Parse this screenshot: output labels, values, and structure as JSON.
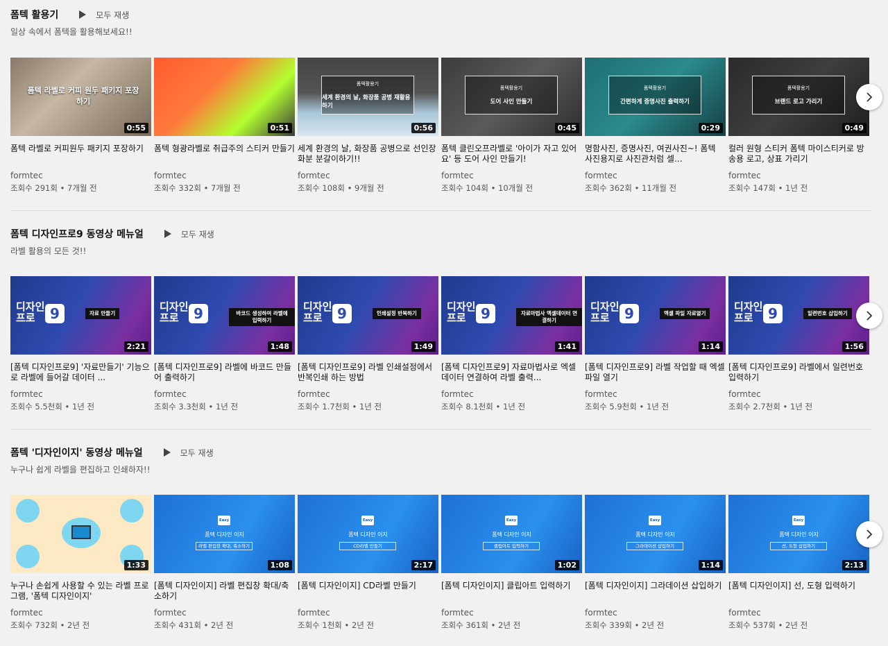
{
  "shelves": [
    {
      "title": "폼텍 활용기",
      "play_all": "모두 재생",
      "subtitle": "일상 속에서 폼텍을 활용해보세요!!",
      "videos": [
        {
          "title": "폼텍 라벨로 커피원두 패키지 포장하기",
          "channel": "formtec",
          "meta": "조회수 291회 • 7개월 전",
          "duration": "0:55",
          "thumb_text": "폼텍 라벨로 커피 원두 패키지 포장하기"
        },
        {
          "title": "폼텍 형광라벨로 취급주의 스티커 만들기",
          "channel": "formtec",
          "meta": "조회수 332회 • 7개월 전",
          "duration": "0:51",
          "thumb_text": ""
        },
        {
          "title": "세계 환경의 날, 화장품 공병으로 선인장 화분 분갈이하기!!",
          "channel": "formtec",
          "meta": "조회수 108회 • 9개월 전",
          "duration": "0:56",
          "thumb_small": "폼텍활용기",
          "thumb_text": "세계 환경의 날, 화장품 공병 재활용하기"
        },
        {
          "title": "폼텍 클린오프라벨로 '아이가 자고 있어요' 등 도어 사인 만들기!",
          "channel": "formtec",
          "meta": "조회수 104회 • 10개월 전",
          "duration": "0:45",
          "thumb_small": "폼텍활용기",
          "thumb_text": "도어 사인 만들기"
        },
        {
          "title": "명함사진, 증명사진, 여권사진~! 폼텍 사진용지로 사진관처럼 셀...",
          "channel": "formtec",
          "meta": "조회수 362회 • 11개월 전",
          "duration": "0:29",
          "thumb_small": "폼텍활용기",
          "thumb_text": "간편하게 증명사진 출력하기"
        },
        {
          "title": "컬러 원형 스티커 폼텍 마이스티커로 방송용 로고, 상표 가리기",
          "channel": "formtec",
          "meta": "조회수 147회 • 1년 전",
          "duration": "0:49",
          "thumb_small": "폼텍활용기",
          "thumb_text": "브랜드 로고 가리기"
        }
      ]
    },
    {
      "title": "폼텍 디자인프로9 동영상 메뉴얼",
      "play_all": "모두 재생",
      "subtitle": "라벨 활용의 모든 것!!",
      "videos": [
        {
          "title": "[폼텍 디자인프로9] '자료만들기' 기능으로 라벨에 들어갈 데이터 ...",
          "channel": "formtec",
          "meta": "조회수 5.5천회 • 1년 전",
          "duration": "2:21",
          "thumb_text": "자료 만들기"
        },
        {
          "title": "[폼텍 디자인프로9] 라벨에 바코드 만들어 출력하기",
          "channel": "formtec",
          "meta": "조회수 3.3천회 • 1년 전",
          "duration": "1:48",
          "thumb_text": "바코드 생성하여 라벨에 입력하기"
        },
        {
          "title": "[폼텍 디자인프로9] 라벨 인쇄설정에서 반복인쇄 하는 방법",
          "channel": "formtec",
          "meta": "조회수 1.7천회 • 1년 전",
          "duration": "1:49",
          "thumb_text": "인쇄설정 반복하기"
        },
        {
          "title": "[폼텍 디자인프로9] 자료마법사로 엑셀 데이터 연결하여 라벨 출력...",
          "channel": "formtec",
          "meta": "조회수 8.1천회 • 1년 전",
          "duration": "1:41",
          "thumb_text": "자료마법사 엑셀데이터 연결하기"
        },
        {
          "title": "[폼텍 디자인프로9] 라벨 작업할 때 엑셀 파일 열기",
          "channel": "formtec",
          "meta": "조회수 5.9천회 • 1년 전",
          "duration": "1:14",
          "thumb_text": "엑셀 파일 자료열기"
        },
        {
          "title": "[폼텍 디자인프로9] 라벨에서 일련번호 입력하기",
          "channel": "formtec",
          "meta": "조회수 2.7천회 • 1년 전",
          "duration": "1:56",
          "thumb_text": "일련번호 삽입하기"
        }
      ],
      "logo_line1": "디자인",
      "logo_line2": "프로",
      "logo_num": "9"
    },
    {
      "title": "폼텍 '디자인이지' 동영상 메뉴얼",
      "play_all": "모두 재생",
      "subtitle": "누구나 쉽게 라벨을 편집하고 인쇄하자!!",
      "videos": [
        {
          "title": "누구나 손쉽게 사용할 수 있는 라벨 프로그램, '폼텍 디자인이지'",
          "channel": "formtec",
          "meta": "조회수 732회 • 2년 전",
          "duration": "1:33",
          "thumb_text": ""
        },
        {
          "title": "[폼텍 디자인이지] 라벨 편집창 확대/축소하기",
          "channel": "formtec",
          "meta": "조회수 431회 • 2년 전",
          "duration": "1:08",
          "thumb_text": "라벨 편집창 확대, 축소하기"
        },
        {
          "title": "[폼텍 디자인이지] CD라벨 만들기",
          "channel": "formtec",
          "meta": "조회수 1천회 • 2년 전",
          "duration": "2:17",
          "thumb_text": "CD라벨 만들기"
        },
        {
          "title": "[폼텍 디자인이지] 클립아트 입력하기",
          "channel": "formtec",
          "meta": "조회수 361회 • 2년 전",
          "duration": "1:02",
          "thumb_text": "클립아트 입력하기"
        },
        {
          "title": "[폼텍 디자인이지] 그라데이션 삽입하기",
          "channel": "formtec",
          "meta": "조회수 339회 • 2년 전",
          "duration": "1:14",
          "thumb_text": "그라데이션 삽입하기"
        },
        {
          "title": "[폼텍 디자인이지] 선, 도형 입력하기",
          "channel": "formtec",
          "meta": "조회수 537회 • 2년 전",
          "duration": "2:13",
          "thumb_text": "선, 도형 삽입하기"
        }
      ],
      "easy_badge": "Easy",
      "easy_title": "폼텍 디자인 이지"
    }
  ],
  "colors": {
    "background": "#f1f1f1",
    "title": "#111111",
    "meta": "#555555"
  },
  "icons": {
    "play_all": "play-triangle-icon",
    "next": "chevron-right-icon"
  }
}
